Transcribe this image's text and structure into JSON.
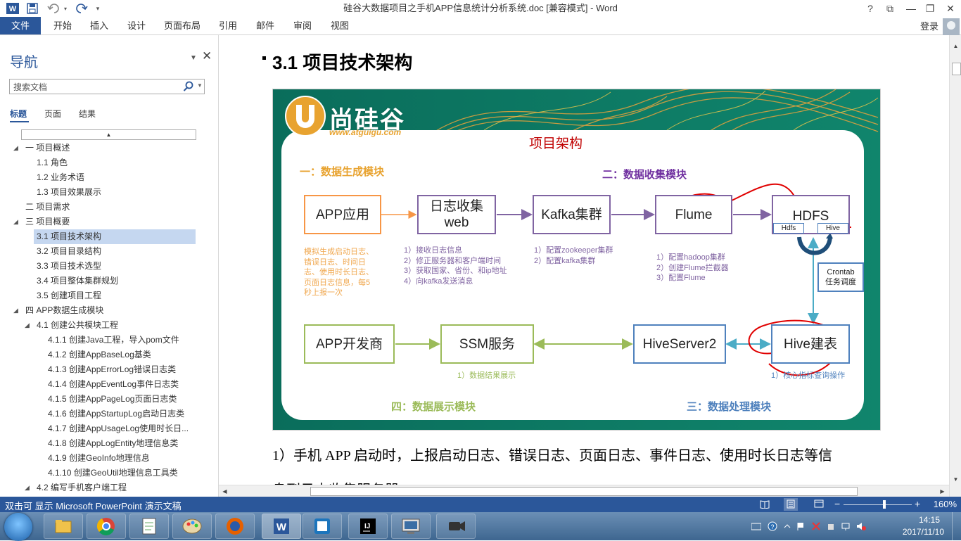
{
  "app": {
    "title": "硅谷大数据项目之手机APP信息统计分析系统.doc [兼容模式] - Word",
    "qat_icons": [
      "word-logo-icon",
      "save-icon",
      "undo-icon",
      "redo-icon",
      "customize-qat-icon"
    ],
    "window_buttons": [
      "?",
      "⧉",
      "—",
      "❐",
      "✕"
    ]
  },
  "ribbon": {
    "tabs": [
      "文件",
      "开始",
      "插入",
      "设计",
      "页面布局",
      "引用",
      "邮件",
      "审阅",
      "视图"
    ],
    "signin": "登录",
    "accent": "#2b579a"
  },
  "nav": {
    "title": "导航",
    "search_placeholder": "搜索文档",
    "tabs": [
      "标题",
      "页面",
      "结果"
    ],
    "tree": [
      {
        "label": "一 项目概述",
        "level": 1,
        "expanded": true
      },
      {
        "label": "1.1 角色",
        "level": 2
      },
      {
        "label": "1.2 业务术语",
        "level": 2
      },
      {
        "label": "1.3 项目效果展示",
        "level": 2
      },
      {
        "label": "二 项目需求",
        "level": 1
      },
      {
        "label": "三 项目概要",
        "level": 1,
        "expanded": true
      },
      {
        "label": "3.1 项目技术架构",
        "level": 2,
        "selected": true
      },
      {
        "label": "3.2 项目目录结构",
        "level": 2
      },
      {
        "label": "3.3 项目技术选型",
        "level": 2
      },
      {
        "label": "3.4 项目整体集群规划",
        "level": 2
      },
      {
        "label": "3.5 创建项目工程",
        "level": 2
      },
      {
        "label": "四 APP数据生成模块",
        "level": 1,
        "expanded": true
      },
      {
        "label": "4.1 创建公共模块工程",
        "level": 2,
        "expanded": true
      },
      {
        "label": "4.1.1 创建Java工程，导入pom文件",
        "level": 3
      },
      {
        "label": "4.1.2 创建AppBaseLog基类",
        "level": 3
      },
      {
        "label": "4.1.3 创建AppErrorLog错误日志类",
        "level": 3
      },
      {
        "label": "4.1.4 创建AppEventLog事件日志类",
        "level": 3
      },
      {
        "label": "4.1.5 创建AppPageLog页面日志类",
        "level": 3
      },
      {
        "label": "4.1.6 创建AppStartupLog启动日志类",
        "level": 3
      },
      {
        "label": "4.1.7 创建AppUsageLog使用时长日...",
        "level": 3
      },
      {
        "label": "4.1.8 创建AppLogEntity地理信息类",
        "level": 3
      },
      {
        "label": "4.1.9 创建GeoInfo地理信息",
        "level": 3
      },
      {
        "label": "4.1.10 创建GeoUtil地理信息工具类",
        "level": 3
      },
      {
        "label": "4.2 编写手机客户端工程",
        "level": 2,
        "expanded": true
      }
    ]
  },
  "document": {
    "heading": "3.1  项目技术架构",
    "paragraph": "1）手机 APP 启动时，上报启动日志、错误日志、页面日志、事件日志、使用时长日志等信",
    "paragraph_next": "息到日志收集服务器"
  },
  "slide": {
    "logo_text": "尚硅谷",
    "logo_url": "www.atguigu.com",
    "title": "项目架构",
    "section1": "一：数据生成模块",
    "section2": "二：数据收集模块",
    "section3": "三：数据处理模块",
    "section4": "四：数据展示模块",
    "boxes": {
      "app": "APP应用",
      "web": "日志收集\nweb",
      "kafka": "Kafka集群",
      "flume": "Flume",
      "hdfs": "HDFS",
      "hdfs_sub1": "Hdfs",
      "hdfs_sub2": "Hive",
      "crontab": "Crontab\n任务调度",
      "dev": "APP开发商",
      "ssm": "SSM服务",
      "hiveserver": "HiveServer2",
      "hive": "Hive建表"
    },
    "notes": {
      "app": "模拟生成启动日志、\n错误日志、时间日\n志、使用时长日志、\n页面日志信息，每5\n秒上报一次",
      "web": "1）接收日志信息\n2）修正服务器和客户端时间\n3）获取国家、省份、和ip地址\n4）向kafka发送消息",
      "kafka": "1）配置zookeeper集群\n2）配置kafka集群",
      "flume": "1）配置hadoop集群\n2）创建Flume拦截器\n3）配置Flume",
      "ssm": "1）数据结果展示",
      "hive": "1）核心指标查询操作"
    },
    "colors": {
      "orange": "#f79646",
      "purple": "#8064a2",
      "green": "#9bbb59",
      "blue": "#4f81bd",
      "title_red": "#c00000",
      "teal": "#0e7a66"
    }
  },
  "statusbar": {
    "text": "双击可 显示 Microsoft PowerPoint 演示文稿",
    "zoom": "160%",
    "zoom_level": 0.6,
    "view_icons": [
      "read-mode-icon",
      "print-layout-icon",
      "web-layout-icon"
    ]
  },
  "taskbar": {
    "apps": [
      "file-explorer-icon",
      "chrome-icon",
      "notepad-plus-icon",
      "paint-icon",
      "firefox-icon",
      "word-icon",
      "virtualbox-icon",
      "intellij-icon",
      "remote-desktop-icon",
      "video-camera-icon"
    ],
    "active": 5,
    "time": "14:15",
    "date": "2017/11/10"
  }
}
